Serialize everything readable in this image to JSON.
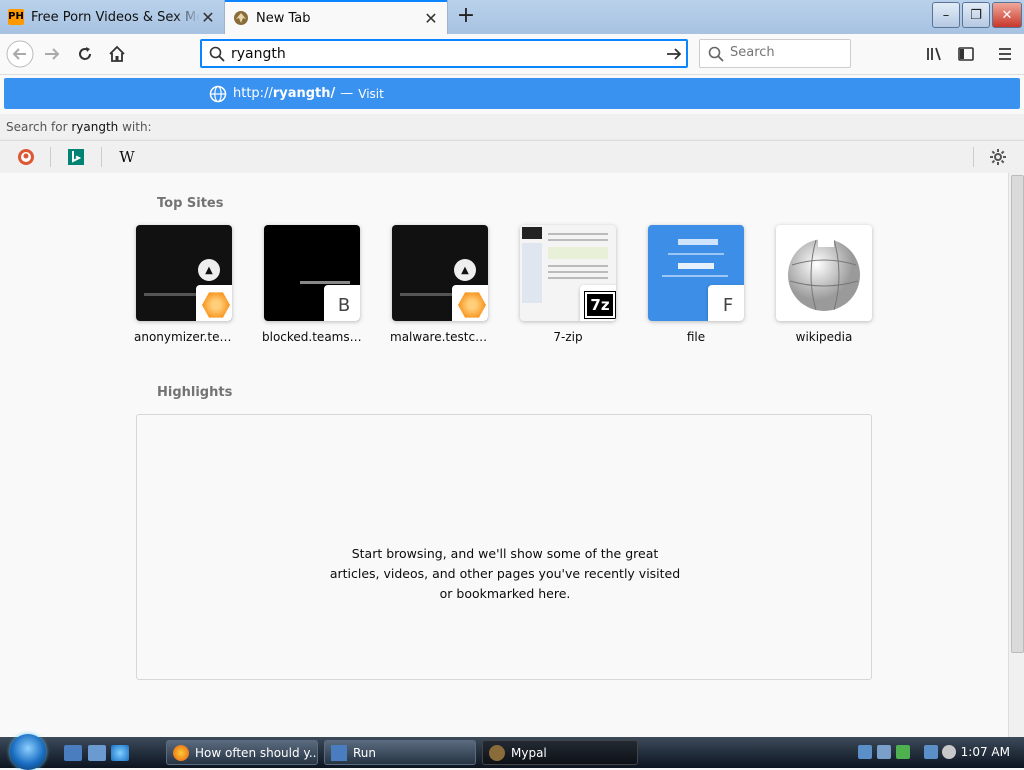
{
  "tabs": [
    {
      "title": "Free Porn Videos & Sex Movies",
      "favicon": "PH",
      "close": "✕"
    },
    {
      "title": "New Tab",
      "close": "✕"
    }
  ],
  "newtab": "+",
  "window_controls": {
    "minimize": "–",
    "maximize": "❐",
    "close": "✕"
  },
  "urlbar": {
    "value": "ryangth"
  },
  "searchbar": {
    "placeholder": "Search"
  },
  "autocomplete": {
    "url_prefix": "http://",
    "url_bold": "ryangth/",
    "dash": "—",
    "action": "Visit",
    "search_for_prefix": "Search for ",
    "search_for_term": "ryangth",
    "search_for_suffix": " with:",
    "engines": [
      "DuckDuckGo",
      "Bing",
      "Wikipedia"
    ],
    "wiki_letter": "W"
  },
  "top_sites": {
    "title": "Top Sites",
    "sites": [
      {
        "label": "anonymizer.test...",
        "badge": ""
      },
      {
        "label": "blocked.teams.c...",
        "badge": "B"
      },
      {
        "label": "malware.testcat...",
        "badge": ""
      },
      {
        "label": "7-zip",
        "badge": "7z"
      },
      {
        "label": "file",
        "badge": "F"
      },
      {
        "label": "wikipedia",
        "badge": ""
      }
    ]
  },
  "highlights": {
    "title": "Highlights",
    "message": "Start browsing, and we'll show some of the great articles, videos, and other pages you've recently visited or bookmarked here."
  },
  "taskbar": {
    "tasks": [
      {
        "label": "How often should y..."
      },
      {
        "label": "Run"
      },
      {
        "label": "Mypal"
      }
    ],
    "clock": "1:07 AM"
  },
  "colors": {
    "accent": "#0a84ff",
    "autocomplete_highlight": "#3a92f0"
  }
}
